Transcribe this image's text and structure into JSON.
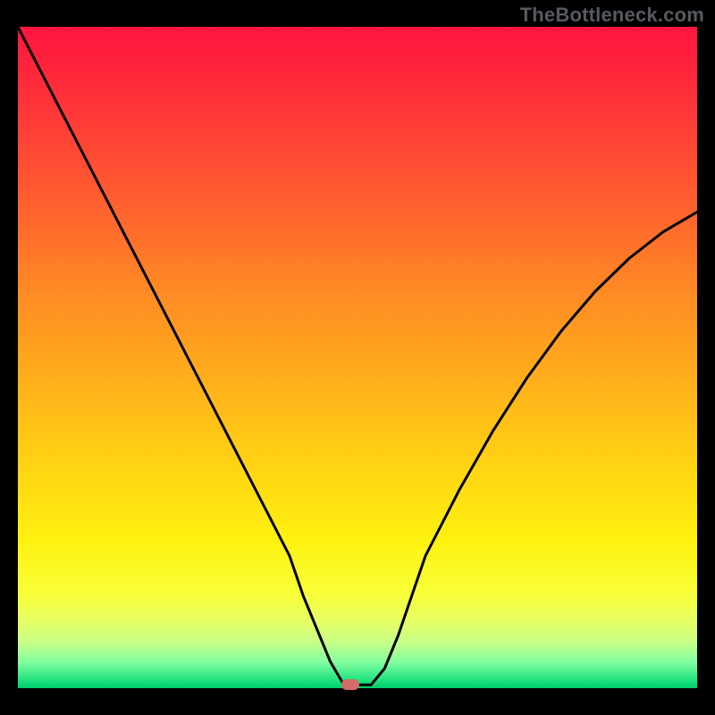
{
  "watermark": "TheBottleneck.com",
  "colors": {
    "frame_bg": "#000000",
    "watermark_text": "#555a5e",
    "curve_stroke": "#000000",
    "marker_fill": "#d46a6a",
    "gradient_stops": [
      {
        "pos": 0.0,
        "hex": "#ff143f"
      },
      {
        "pos": 0.1,
        "hex": "#ff2f3a"
      },
      {
        "pos": 0.25,
        "hex": "#ff5a30"
      },
      {
        "pos": 0.4,
        "hex": "#ff8a24"
      },
      {
        "pos": 0.55,
        "hex": "#ffb31a"
      },
      {
        "pos": 0.68,
        "hex": "#ffd812"
      },
      {
        "pos": 0.78,
        "hex": "#fff210"
      },
      {
        "pos": 0.86,
        "hex": "#f8ff3a"
      },
      {
        "pos": 0.9,
        "hex": "#e6ff66"
      },
      {
        "pos": 0.93,
        "hex": "#c8ff86"
      },
      {
        "pos": 0.96,
        "hex": "#84ffa0"
      },
      {
        "pos": 0.99,
        "hex": "#18e07c"
      },
      {
        "pos": 1.0,
        "hex": "#00c96a"
      }
    ]
  },
  "chart_data": {
    "type": "line",
    "title": "",
    "xlabel": "",
    "ylabel": "",
    "xlim": [
      0,
      100
    ],
    "ylim": [
      0,
      100
    ],
    "series": [
      {
        "name": "bottleneck-curve",
        "x": [
          0,
          5,
          10,
          15,
          20,
          25,
          30,
          35,
          40,
          42,
          44,
          46,
          48,
          50,
          52,
          54,
          56,
          58,
          60,
          65,
          70,
          75,
          80,
          85,
          90,
          95,
          100
        ],
        "values": [
          100,
          90,
          80,
          70,
          60,
          50,
          40,
          30,
          20,
          14,
          9,
          4,
          0.5,
          0.5,
          0.5,
          3,
          8,
          14,
          20,
          30,
          39,
          47,
          54,
          60,
          65,
          69,
          72
        ]
      }
    ],
    "marker": {
      "x": 49,
      "y": 0.5
    },
    "grid": false,
    "legend": false
  }
}
